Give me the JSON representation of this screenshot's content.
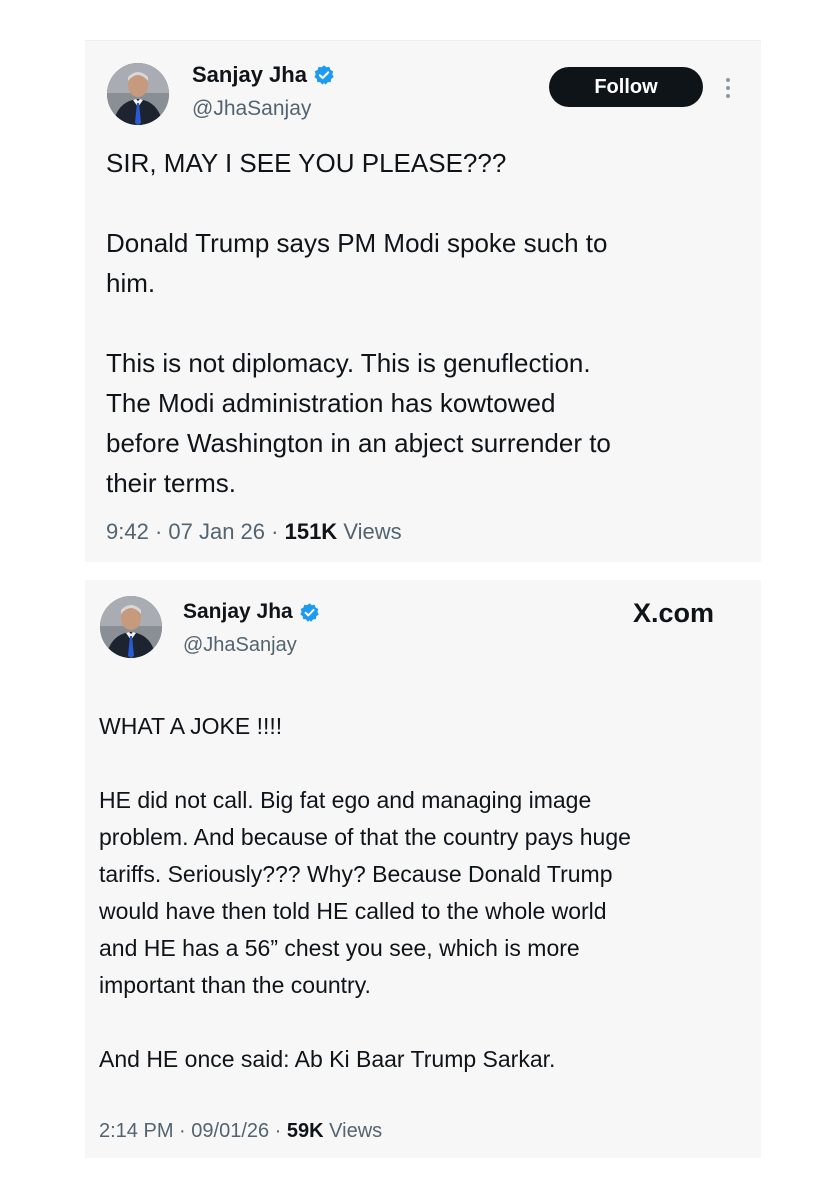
{
  "tweet1": {
    "author_name": "Sanjay Jha",
    "author_handle": "@JhaSanjay",
    "follow_label": "Follow",
    "paragraphs": [
      "SIR, MAY I SEE YOU PLEASE???",
      "Donald Trump says PM Modi spoke such to\nhim.",
      "This is not diplomacy. This is genuflection.\nThe Modi administration has kowtowed\nbefore Washington in an abject surrender to\ntheir terms."
    ],
    "time": "9:42",
    "date": "07 Jan 26",
    "views_count": "151K",
    "views_label": "Views",
    "separator": " · "
  },
  "tweet2": {
    "author_name": "Sanjay Jha",
    "author_handle": "@JhaSanjay",
    "site_label": "X.com",
    "paragraphs": [
      "WHAT A JOKE !!!!",
      "HE did not call. Big fat ego and managing image\nproblem. And because of that the country pays huge\ntariffs. Seriously??? Why? Because Donald Trump\nwould have then told HE called to the whole world\nand HE has a 56” chest you see, which is more\nimportant than the country.",
      "And HE once said: Ab Ki Baar Trump Sarkar."
    ],
    "time": "2:14 PM",
    "date": "09/01/26",
    "views_count": "59K",
    "views_label": "Views",
    "separator": " · "
  },
  "colors": {
    "card_background": "#f7f7f8",
    "text_primary": "#0f1419",
    "text_secondary": "#536471",
    "verified_badge": "#1d9bf0",
    "follow_button": "#0f1419"
  },
  "icons": {
    "verified": "verified-badge-icon",
    "more": "more-options-icon"
  }
}
